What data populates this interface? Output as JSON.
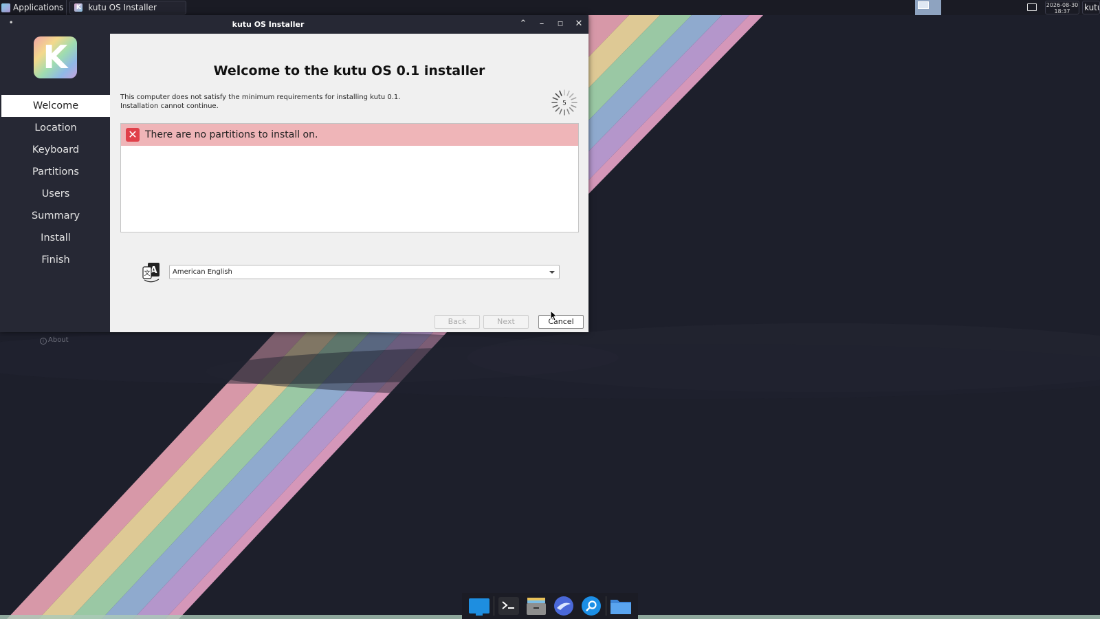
{
  "topbar": {
    "applications_label": "Applications",
    "task_title": "kutu OS Installer",
    "clock_date": "2026-08-30",
    "clock_time": "18:37",
    "user_label": "kutu"
  },
  "window": {
    "title": "kutu OS Installer"
  },
  "sidebar": {
    "logo_letter": "K",
    "items": [
      {
        "label": "Welcome",
        "active": true
      },
      {
        "label": "Location"
      },
      {
        "label": "Keyboard"
      },
      {
        "label": "Partitions"
      },
      {
        "label": "Users"
      },
      {
        "label": "Summary"
      },
      {
        "label": "Install"
      },
      {
        "label": "Finish"
      }
    ],
    "about_label": "About"
  },
  "content": {
    "heading": "Welcome to the kutu OS 0.1 installer",
    "requirements_line1": "This computer does not satisfy the minimum requirements for installing kutu 0.1.",
    "requirements_line2": "Installation cannot continue.",
    "spinner_count": "5",
    "error_message": "There are no partitions to install on.",
    "language_selected": "American English",
    "buttons": {
      "back": "Back",
      "next": "Next",
      "cancel": "Cancel"
    }
  },
  "dock": {
    "icons": [
      "desktop-icon",
      "terminal-icon",
      "archive-icon",
      "browser-icon",
      "search-icon",
      "folder-icon"
    ]
  },
  "colors": {
    "error_banner": "#efb5b8",
    "error_icon": "#e0404a",
    "window_dark": "#262834",
    "desktop_bg": "#1d1f2b"
  }
}
